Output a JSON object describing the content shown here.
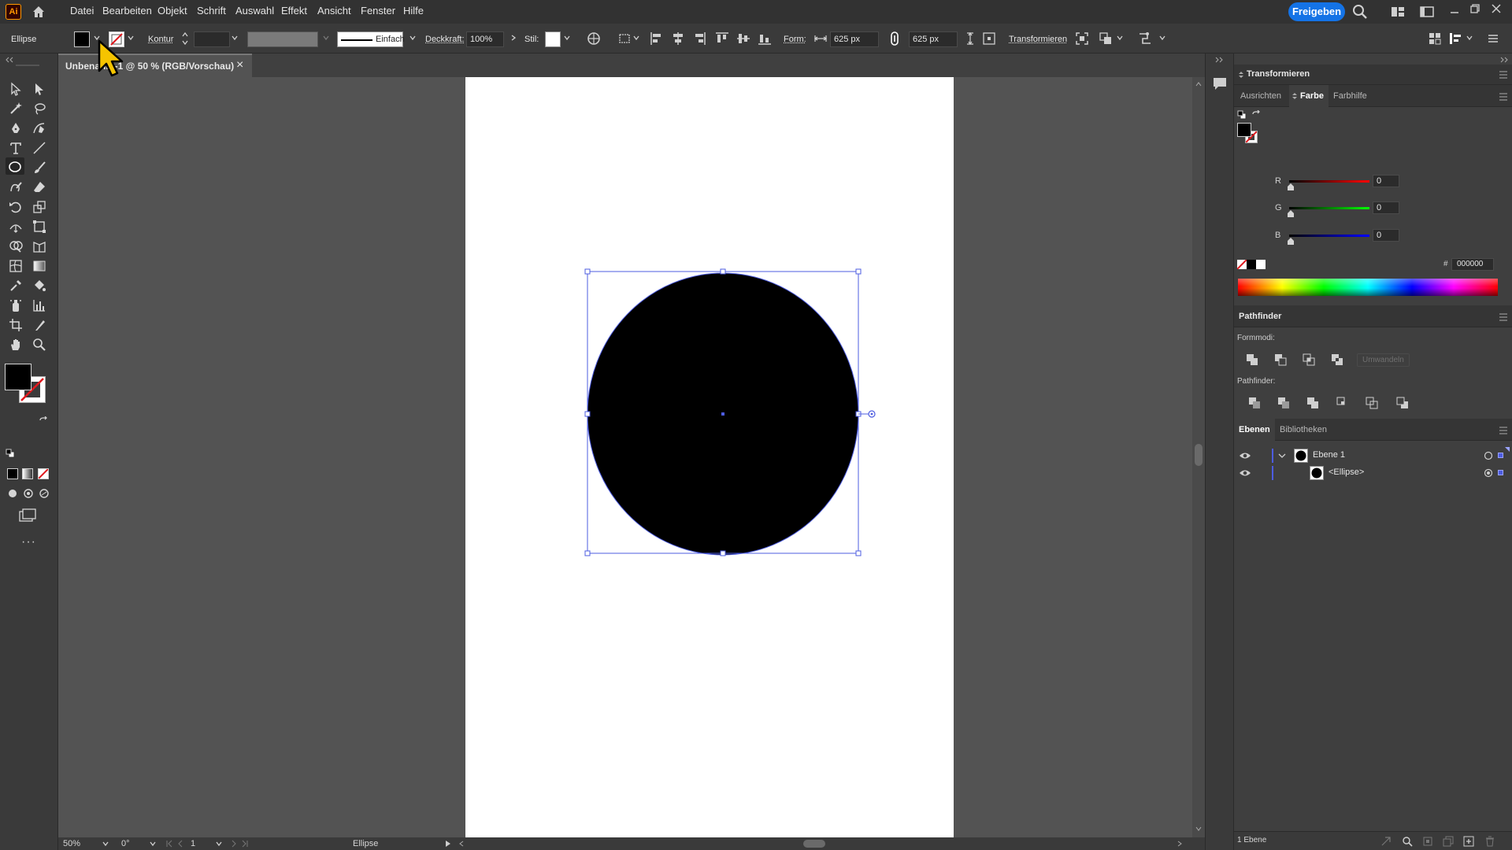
{
  "app": {
    "logo": "Ai",
    "accent": "#ff9a00",
    "selection_color": "#4d5ce0"
  },
  "menu": [
    "Datei",
    "Bearbeiten",
    "Objekt",
    "Schrift",
    "Auswahl",
    "Effekt",
    "Ansicht",
    "Fenster",
    "Hilfe"
  ],
  "share_button": "Freigeben",
  "control": {
    "object_type": "Ellipse",
    "stroke_label": "Kontur",
    "stroke_style": "Einfach",
    "opacity_label": "Deckkraft:",
    "opacity_value": "100%",
    "style_label": "Stil:",
    "shape_label": "Form:",
    "width_value": "625 px",
    "height_value": "625 px",
    "transform_label": "Transformieren"
  },
  "tab": {
    "title": "Unbenannt-1 @ 50 % (RGB/Vorschau)",
    "close": "×"
  },
  "status": {
    "zoom": "50%",
    "rotation": "0°",
    "artboard": "1",
    "tool": "Ellipse"
  },
  "panels": {
    "transform_title": "Transformieren",
    "subtabs": [
      "Ausrichten",
      "Farbe",
      "Farbhilfe"
    ],
    "color": {
      "r_label": "R",
      "g_label": "G",
      "b_label": "B",
      "r": "0",
      "g": "0",
      "b": "0",
      "hex_label": "#",
      "hex": "000000"
    },
    "pathfinder_title": "Pathfinder",
    "shape_modes": "Formmodi:",
    "expand_button": "Umwandeln",
    "pathfinders": "Pathfinder:",
    "layers_tabs": [
      "Ebenen",
      "Bibliotheken"
    ],
    "layers": [
      {
        "name": "Ebene 1"
      },
      {
        "name": "<Ellipse>"
      }
    ],
    "layers_count": "1 Ebene"
  }
}
